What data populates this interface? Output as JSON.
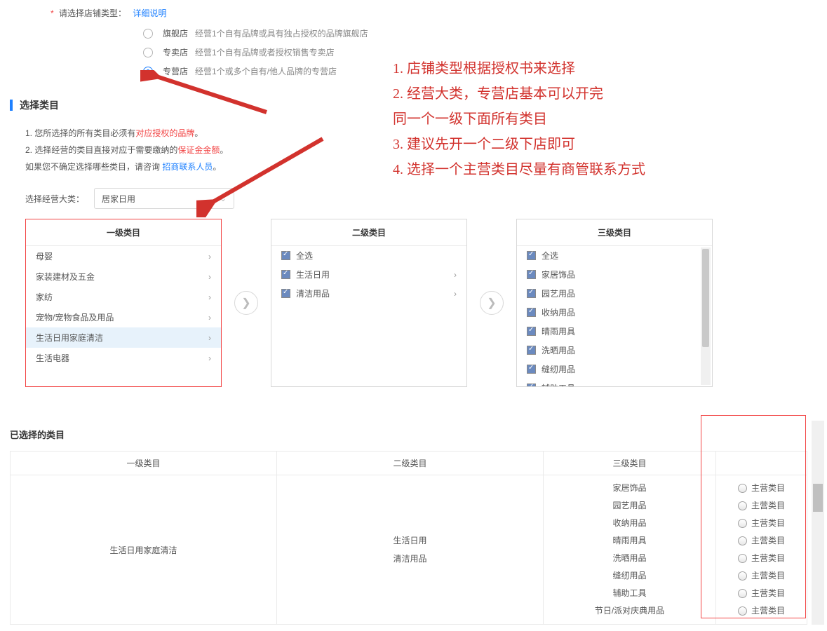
{
  "storeTypeSection": {
    "requiredMark": "*",
    "label": "请选择店铺类型：",
    "detailLink": "详细说明"
  },
  "storeTypes": [
    {
      "label": "旗舰店",
      "desc": "经营1个自有品牌或具有独占授权的品牌旗舰店",
      "selected": false
    },
    {
      "label": "专卖店",
      "desc": "经营1个自有品牌或者授权销售专卖店",
      "selected": false
    },
    {
      "label": "专营店",
      "desc": "经营1个或多个自有/他人品牌的专营店",
      "selected": true
    }
  ],
  "categorySection": {
    "heading": "选择类目",
    "line1_a": "1. 您所选择的所有类目必须有",
    "line1_b": "对应授权的品牌",
    "line1_c": "。",
    "line2_a": "2. 选择经营的类目直接对应于需要缴纳的",
    "line2_b": "保证金金额",
    "line2_c": "。",
    "line3_a": "如果您不确定选择哪些类目，请咨询 ",
    "line3_b": "招商联系人员",
    "line3_c": "。",
    "selectLabel": "选择经营大类：",
    "selectedMajor": "居家日用"
  },
  "panelHeaders": {
    "l1": "一级类目",
    "l2": "二级类目",
    "l3": "三级类目"
  },
  "level1": [
    {
      "name": "母婴",
      "active": false
    },
    {
      "name": "家装建材及五金",
      "active": false
    },
    {
      "name": "家纺",
      "active": false
    },
    {
      "name": "宠物/宠物食品及用品",
      "active": false
    },
    {
      "name": "生活日用家庭清洁",
      "active": true
    },
    {
      "name": "生活电器",
      "active": false
    }
  ],
  "level2_all": "全选",
  "level2": [
    {
      "name": "生活日用"
    },
    {
      "name": "清洁用品"
    }
  ],
  "level3_all": "全选",
  "level3": [
    {
      "name": "家居饰品"
    },
    {
      "name": "园艺用品"
    },
    {
      "name": "收纳用品"
    },
    {
      "name": "晴雨用具"
    },
    {
      "name": "洗晒用品"
    },
    {
      "name": "缝纫用品"
    },
    {
      "name": "辅助工具"
    },
    {
      "name": "节日/派对庆典用品"
    }
  ],
  "annotations": [
    "1. 店铺类型根据授权书来选择",
    "2. 经营大类，专营店基本可以开完",
    "同一个一级下面所有类目",
    "3. 建议先开一个二级下店即可",
    "4. 选择一个主营类目尽量有商管联系方式"
  ],
  "selectedBlock": {
    "title": "已选择的类目",
    "th1": "一级类目",
    "th2": "二级类目",
    "th3": "三级类目",
    "l1": "生活日用家庭清洁",
    "l2": [
      "生活日用",
      "清洁用品"
    ],
    "l3": [
      "家居饰品",
      "园艺用品",
      "收纳用品",
      "晴雨用具",
      "洗晒用品",
      "缝纫用品",
      "辅助工具",
      "节日/派对庆典用品"
    ],
    "mainLabel": "主营类目"
  }
}
